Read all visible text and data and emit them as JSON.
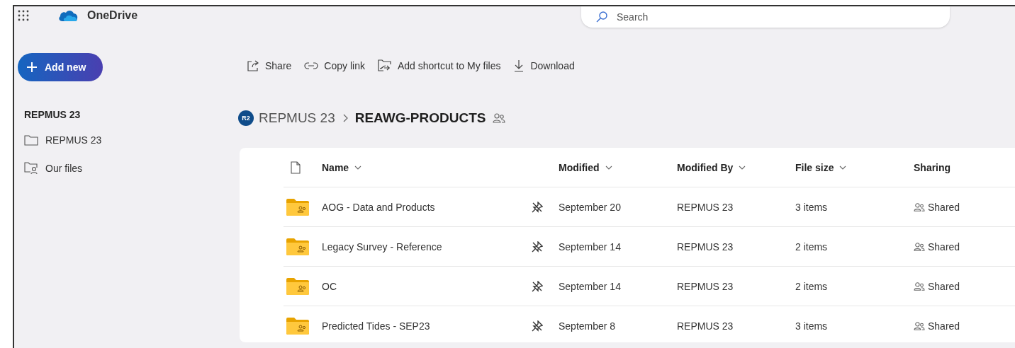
{
  "app": {
    "name": "OneDrive"
  },
  "search": {
    "placeholder": "Search"
  },
  "add_button": {
    "label": "Add new"
  },
  "sidebar": {
    "heading": "REPMUS 23",
    "items": [
      {
        "label": "REPMUS 23",
        "kind": "folder"
      },
      {
        "label": "Our files",
        "kind": "shared-files"
      }
    ]
  },
  "commands": [
    {
      "label": "Share",
      "kind": "share"
    },
    {
      "label": "Copy link",
      "kind": "link"
    },
    {
      "label": "Add shortcut to My files",
      "kind": "shortcut"
    },
    {
      "label": "Download",
      "kind": "download"
    }
  ],
  "breadcrumb": [
    {
      "label": "REPMUS 23",
      "badge": "R2",
      "current": false
    },
    {
      "label": "REAWG-PRODUCTS",
      "current": true,
      "shared": true
    }
  ],
  "table": {
    "columns": [
      {
        "label": "Name",
        "sortable": true
      },
      {
        "label": "Modified",
        "sortable": true
      },
      {
        "label": "Modified By",
        "sortable": true
      },
      {
        "label": "File size",
        "sortable": true
      },
      {
        "label": "Sharing",
        "sortable": false
      }
    ],
    "rows": [
      {
        "name": "AOG - Data and Products",
        "modified": "September 20",
        "modified_by": "REPMUS 23",
        "file_size": "3 items",
        "sharing": "Shared"
      },
      {
        "name": "Legacy Survey - Reference",
        "modified": "September 14",
        "modified_by": "REPMUS 23",
        "file_size": "2 items",
        "sharing": "Shared"
      },
      {
        "name": "OC",
        "modified": "September 14",
        "modified_by": "REPMUS 23",
        "file_size": "2 items",
        "sharing": "Shared"
      },
      {
        "name": "Predicted Tides - SEP23",
        "modified": "September 8",
        "modified_by": "REPMUS 23",
        "file_size": "3 items",
        "sharing": "Shared"
      }
    ]
  }
}
